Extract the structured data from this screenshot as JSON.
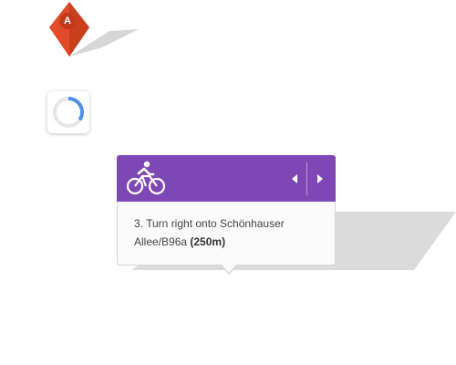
{
  "marker": {
    "label": "A",
    "icon": "map-pin-icon",
    "color": "#e04b2c"
  },
  "loader": {
    "icon": "loading-spinner-icon",
    "track_color": "#e6e6e6",
    "arc_color": "#4f8fe8"
  },
  "popup": {
    "header_color": "#7e48b4",
    "mode_icon": "bicycle-icon",
    "prev_icon": "caret-left-icon",
    "next_icon": "caret-right-icon",
    "instruction_text": "3. Turn right onto Schönhauser Allee/B96a",
    "distance_text": "(250m)"
  }
}
